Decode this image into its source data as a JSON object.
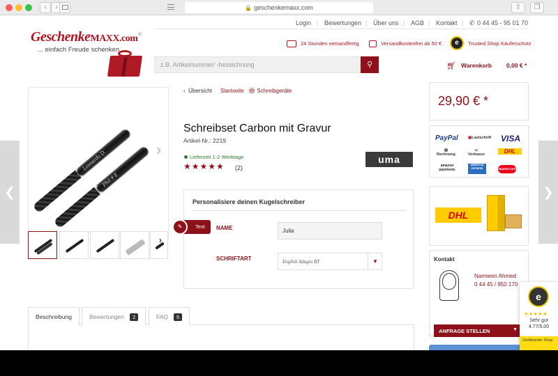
{
  "browser": {
    "url": "geschenkemaxx.com",
    "back": "‹",
    "forward": "›"
  },
  "logo": {
    "name_main": "Geschenke",
    "name_maxx": "MAXX.com",
    "registered": "®",
    "slogan": "... einfach Freude schenken"
  },
  "topnav": {
    "login": "Login",
    "reviews": "Bewertungen",
    "about": "Über uns",
    "agb": "AGB",
    "contact": "Kontakt",
    "phone": "0 44 45 - 95 01 70"
  },
  "usps": {
    "shipping": "24 Stunden versandfertig",
    "free": "Versandkostenfrei ab 50 €",
    "trusted": "Trusted Shop Käuferschutz"
  },
  "search": {
    "placeholder": "z.B. Artikelnummer/ -bezeichnung"
  },
  "cart": {
    "label": "Warenkorb",
    "total": "0,00 € *"
  },
  "breadcrumb": {
    "back": "Übersicht",
    "home": "Startseite",
    "category": "Schreibgeräte"
  },
  "product": {
    "title": "Schreibset Carbon mit Gravur",
    "article_no": "Artikel-Nr.: 2219",
    "delivery": "Lieferzeit 1-2 Werktage",
    "stars": "★★★★★",
    "review_count": "(2)",
    "brand": "uma",
    "price": "29,90 € *",
    "engraving_1": "Leonardo D.",
    "engraving_2": "Phil # 8"
  },
  "personalize": {
    "title": "Personalisiere deinen Kugelschreiber",
    "tag": "Text",
    "name_label": "NAME",
    "name_value": "Julia",
    "font_label": "SCHRIFTART",
    "font_value": "English Adagio BT"
  },
  "tabs": [
    {
      "label": "Beschreibung",
      "badge": ""
    },
    {
      "label": "Bewertungen",
      "badge": "2"
    },
    {
      "label": "FAQ",
      "badge": "5"
    }
  ],
  "payments": {
    "paypal": "PayPal",
    "lastschrift": "Lastschrift",
    "visa": "VISA",
    "rechnung": "Rechnung",
    "vorkasse": "Vorkasse",
    "dhl_nachnahme": "DHL",
    "amazon": "amazon payments",
    "amex": "AMERICAN EXPRESS",
    "mastercard": "MasterCard"
  },
  "dhl": {
    "logo": "DHL"
  },
  "contact": {
    "title": "Kontakt",
    "name": "Narmeen Ahmed",
    "phone": "0 44 45 / 950 170",
    "button": "ANFRAGE STELLEN"
  },
  "trustedshops": {
    "seal": "e",
    "stars": "★★★★★",
    "label": "Sehr gut",
    "score": "4.77/5.00",
    "footer": "Zertifizierter Shop"
  },
  "colors": {
    "brand": "#8e1019",
    "logo_red": "#b3141f",
    "delivery_green": "#2e7d32"
  }
}
